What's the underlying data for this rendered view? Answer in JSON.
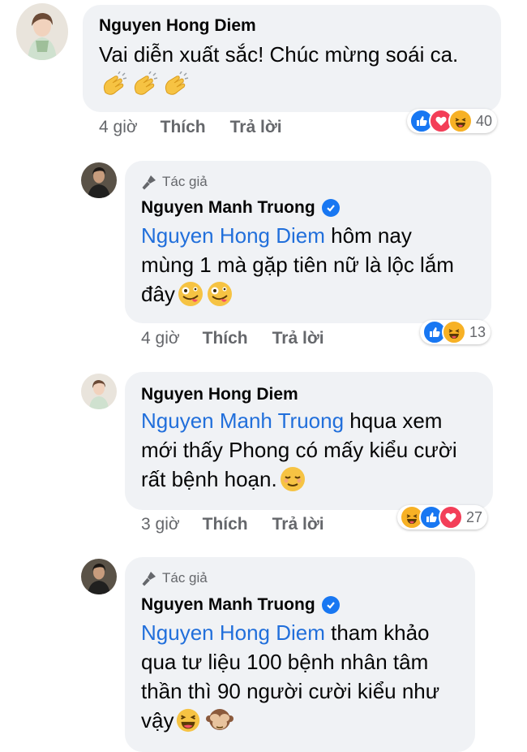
{
  "comments": [
    {
      "author": "Nguyen Hong Diem",
      "text": "Vai diễn xuất sắc! Chúc mừng soái ca.",
      "time": "4 giờ",
      "like_label": "Thích",
      "reply_label": "Trả lời",
      "reaction_count": "40",
      "reactions": [
        "like-icon",
        "love-icon",
        "haha-icon"
      ]
    },
    {
      "badge": "Tác giả",
      "author": "Nguyen Manh Truong",
      "mention": "Nguyen Hong Diem",
      "text_line1": " hôm nay",
      "text_line2": "mùng 1 mà gặp tiên nữ là lộc lắm",
      "text_line3": "đây",
      "time": "4 giờ",
      "like_label": "Thích",
      "reply_label": "Trả lời",
      "reaction_count": "13",
      "reactions": [
        "like-icon",
        "haha-icon"
      ]
    },
    {
      "author": "Nguyen Hong Diem",
      "mention": "Nguyen Manh Truong",
      "text_line1": " hqua xem",
      "text_line2": "mới thấy Phong có mấy kiểu cười",
      "text_line3": "rất bệnh hoạn.",
      "time": "3 giờ",
      "like_label": "Thích",
      "reply_label": "Trả lời",
      "reaction_count": "27",
      "reactions": [
        "haha-icon",
        "like-icon",
        "love-icon"
      ]
    },
    {
      "badge": "Tác giả",
      "author": "Nguyen Manh Truong",
      "mention": "Nguyen Hong Diem",
      "text_line1": " tham khảo",
      "text_line2": "qua tư liệu 100 bệnh nhân tâm",
      "text_line3": "thần thì 90 người cười kiểu như",
      "text_line4": "vậy"
    }
  ],
  "colors": {
    "bubble": "#f0f2f5",
    "mention": "#216fdb",
    "like": "#1877f2",
    "love": "#f33e58",
    "haha": "#f7b125"
  }
}
